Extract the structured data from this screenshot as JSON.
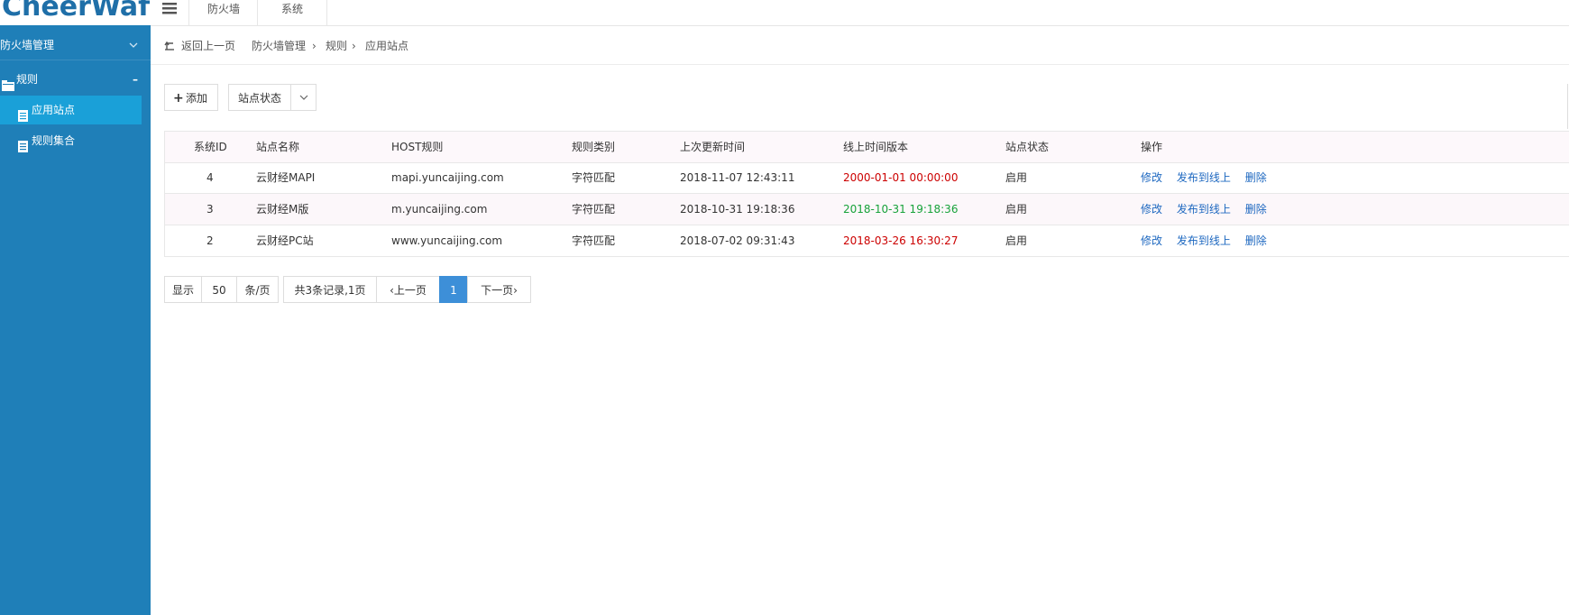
{
  "app": {
    "logo_text": "CheerWaf"
  },
  "topnav": {
    "items": [
      {
        "label": "防火墙"
      },
      {
        "label": "系统"
      }
    ]
  },
  "sidebar": {
    "group_label": "防火墙管理",
    "rules_label": "规则",
    "items": [
      {
        "label": "应用站点",
        "active": true
      },
      {
        "label": "规则集合",
        "active": false
      }
    ]
  },
  "breadcrumb": {
    "back_label": "返回上一页",
    "path": [
      "防火墙管理",
      "规则",
      "应用站点"
    ]
  },
  "toolbar": {
    "add_label": "添加",
    "status_filter_label": "站点状态"
  },
  "table": {
    "headers": [
      "系统ID",
      "站点名称",
      "HOST规则",
      "规则类别",
      "上次更新时间",
      "线上时间版本",
      "站点状态",
      "操作"
    ],
    "rows": [
      {
        "id": "4",
        "name": "云财经MAPI",
        "host": "mapi.yuncaijing.com",
        "type": "字符匹配",
        "updated": "2018-11-07 12:43:11",
        "version": "2000-01-01 00:00:00",
        "version_color": "#cc0000",
        "status": "启用"
      },
      {
        "id": "3",
        "name": "云财经M版",
        "host": "m.yuncaijing.com",
        "type": "字符匹配",
        "updated": "2018-10-31 19:18:36",
        "version": "2018-10-31 19:18:36",
        "version_color": "#17a23a",
        "status": "启用"
      },
      {
        "id": "2",
        "name": "云财经PC站",
        "host": "www.yuncaijing.com",
        "type": "字符匹配",
        "updated": "2018-07-02 09:31:43",
        "version": "2018-03-26 16:30:27",
        "version_color": "#cc0000",
        "status": "启用"
      }
    ],
    "actions": [
      "修改",
      "发布到线上",
      "删除"
    ]
  },
  "pagination": {
    "show_label": "显示",
    "page_size": "50",
    "per_page_label": "条/页",
    "total_label": "共3条记录,1页",
    "prev_label": "‹上一页",
    "current_page": "1",
    "next_label": "下一页›"
  },
  "colors": {
    "sidebar_bg": "#1f7fb8",
    "sidebar_active": "#1aa0d8",
    "link": "#1e68c0",
    "page_active": "#3d8fd8"
  }
}
